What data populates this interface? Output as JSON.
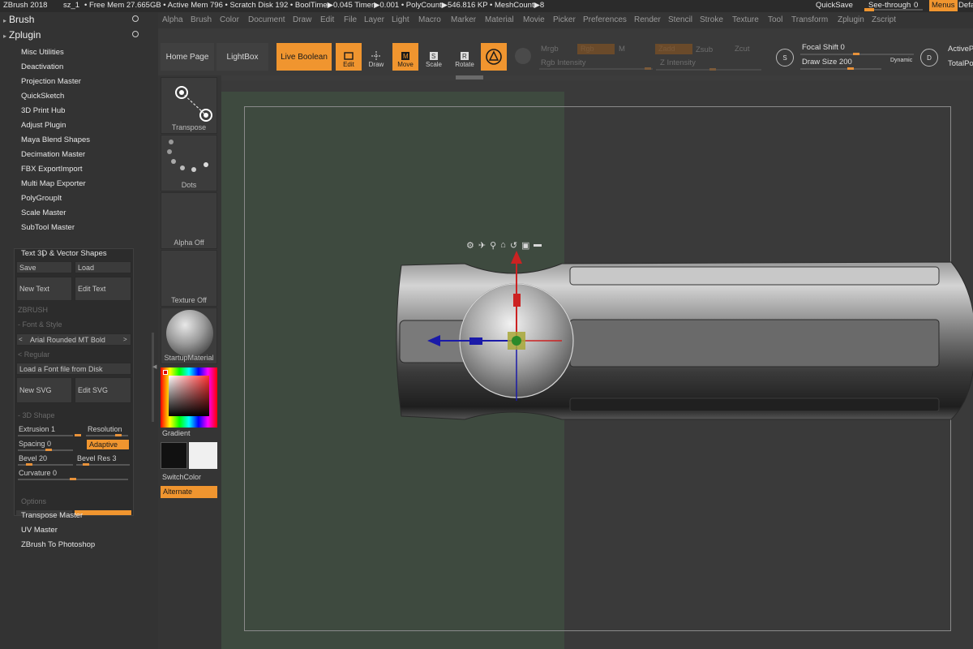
{
  "topbar": {
    "app": "ZBrush 2018",
    "doc": "sz_1",
    "stats": "• Free Mem 27.665GB • Active Mem 796 • Scratch Disk 192 • BoolTime▶0.045 Timer▶0.001 • PolyCount▶546.816 KP • MeshCount▶8",
    "quicksave": "QuickSave",
    "seethrough": "See-through",
    "seethrough_value": "0",
    "menus": "Menus",
    "default": "Defa"
  },
  "menubar": [
    "Alpha",
    "Brush",
    "Color",
    "Document",
    "Draw",
    "Edit",
    "File",
    "Layer",
    "Light",
    "Macro",
    "Marker",
    "Material",
    "Movie",
    "Picker",
    "Preferences",
    "Render",
    "Stencil",
    "Stroke",
    "Texture",
    "Tool",
    "Transform",
    "Zplugin",
    "Zscript"
  ],
  "leftpanel": {
    "brush": "Brush",
    "zplugin": "Zplugin",
    "items": [
      "Misc Utilities",
      "Deactivation",
      "Projection Master",
      "QuickSketch",
      "3D Print Hub",
      "Adjust Plugin",
      "Maya Blend Shapes",
      "Decimation Master",
      "FBX ExportImport",
      "Multi Map Exporter",
      "PolyGroupIt",
      "Scale Master",
      "SubTool Master"
    ],
    "text3d": {
      "title": "Text 3D & Vector Shapes",
      "save": "Save",
      "load": "Load",
      "new_text": "New Text",
      "edit_text": "Edit Text",
      "zbrush": "ZBRUSH",
      "font_style": "Font & Style",
      "font": "Arial Rounded MT Bold",
      "regular": "Regular",
      "load_font": "Load a Font file from Disk",
      "new_svg": "New SVG",
      "edit_svg": "Edit SVG",
      "shape3d": "3D Shape",
      "extrusion": "Extrusion 1",
      "resolution": "Resolution",
      "spacing": "Spacing 0",
      "adaptive": "Adaptive",
      "bevel": "Bevel 20",
      "bevel_res": "Bevel Res 3",
      "curvature": "Curvature 0",
      "options": "Options"
    },
    "bottom_items": [
      "Transpose Master",
      "UV Master",
      "ZBrush To Photoshop"
    ]
  },
  "shelf": {
    "home": "Home Page",
    "lightbox": "LightBox",
    "liveboolean": "Live Boolean",
    "edit": "Edit",
    "draw": "Draw",
    "move": "Move",
    "scale": "Scale",
    "rotate": "Rotate",
    "mrgb": "Mrgb",
    "rgb": "Rgb",
    "m": "M",
    "rgb_intensity": "Rgb Intensity",
    "zadd": "Zadd",
    "zsub": "Zsub",
    "zcut": "Zcut",
    "z_intensity": "Z Intensity",
    "focal_shift": "Focal Shift 0",
    "draw_size": "Draw Size 200",
    "dynamic": "Dynamic",
    "active_points": "ActiveP",
    "total_points": "TotalPo"
  },
  "tray": {
    "transpose": "Transpose",
    "dots": "Dots",
    "alpha_off": "Alpha Off",
    "texture_off": "Texture Off",
    "material": "StartupMaterial",
    "gradient": "Gradient",
    "switchcolor": "SwitchColor",
    "alternate": "Alternate"
  },
  "colors": {
    "accent": "#f0952f",
    "x_axis": "#cc2222",
    "y_axis": "#1a1aa8",
    "z_axis": "#2a8a2a"
  }
}
